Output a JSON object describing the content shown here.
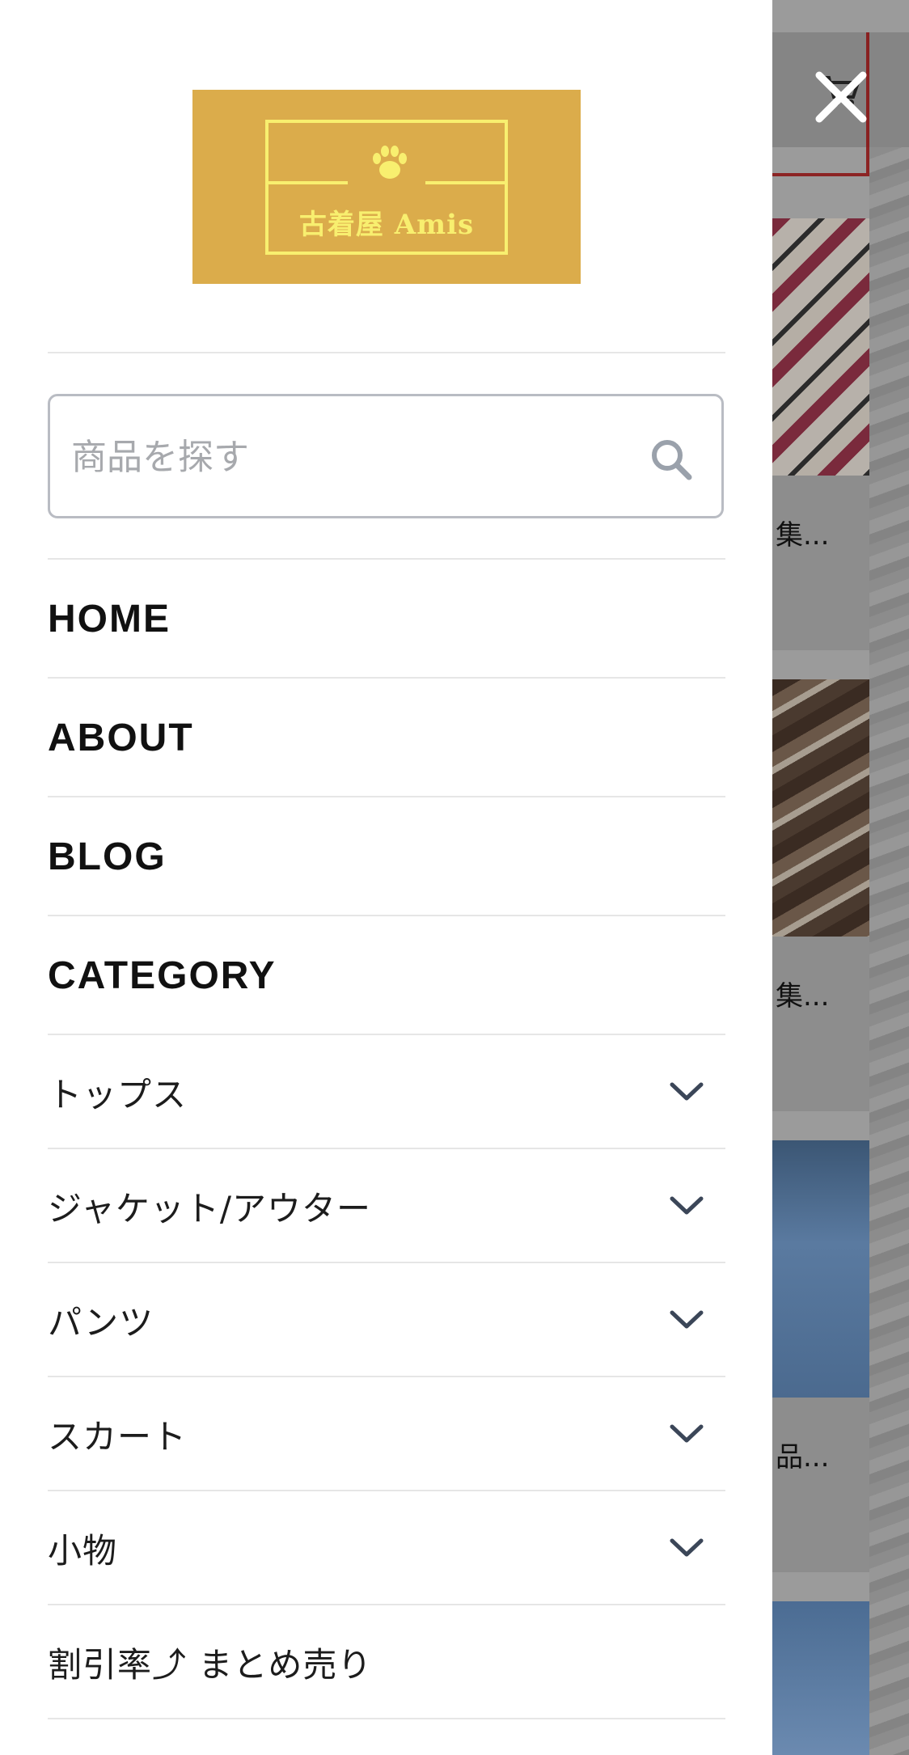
{
  "logo": {
    "text": "古着屋 Amis",
    "colors": {
      "background": "#dbac4b",
      "foreground": "#f8ef6f"
    }
  },
  "search": {
    "placeholder": "商品を探す",
    "value": ""
  },
  "nav": [
    {
      "label": "HOME"
    },
    {
      "label": "ABOUT"
    },
    {
      "label": "BLOG"
    },
    {
      "label": "CATEGORY"
    }
  ],
  "categories": [
    {
      "label": "トップス",
      "icon": "chevron-down-icon"
    },
    {
      "label": "ジャケット/アウター",
      "icon": "chevron-down-icon"
    },
    {
      "label": "パンツ",
      "icon": "chevron-down-icon"
    },
    {
      "label": "スカート",
      "icon": "chevron-down-icon"
    },
    {
      "label": "小物",
      "icon": "chevron-down-icon"
    },
    {
      "label": "割引率⤴ まとめ売り"
    }
  ],
  "background_page": {
    "product_names": [
      "集...",
      "集...",
      "品..."
    ]
  },
  "icons": {
    "close": "close-icon",
    "search": "search-icon",
    "cart": "cart-icon",
    "paw": "paw-icon"
  }
}
